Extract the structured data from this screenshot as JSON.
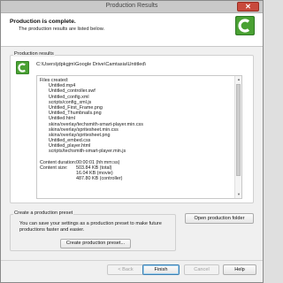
{
  "window": {
    "title": "Production Results",
    "close_glyph": "✕"
  },
  "header": {
    "title": "Production is complete.",
    "subtitle": "The production results are listed below.",
    "logo_icon": "camtasia-logo"
  },
  "results": {
    "group_label": "Production results",
    "path": "C:\\Users\\jdpkgjm\\Google Drive\\Camtasia\\Untitled\\",
    "files_label": "Files created:",
    "files": [
      "Untitled.mp4",
      "Untitled_controller.swf",
      "Untitled_config.xml",
      "scripts/config_xml.js",
      "Untitled_First_Frame.png",
      "Untitled_Thumbnails.png",
      "Untitled.html",
      "skins/overlay/techsmith-smart-player.min.css",
      "skins/overlay/spritesheet.min.css",
      "skins/overlay/spritesheet.png",
      "Untitled_embed.css",
      "Untitled_player.html",
      "scripts/techsmith-smart-player.min.js"
    ],
    "duration_label": "Content duration:",
    "duration_value": "00:00:01 (hh:mm:ss)",
    "size_label": "Content size:",
    "size_values": [
      "503.84 KB (total)",
      "16.04 KB (movie)",
      "487.80 KB (controller)"
    ]
  },
  "preset": {
    "group_label": "Create a production preset",
    "description": "You can save your settings as a production preset to make future productions faster and easier.",
    "button_label": "Create production preset..."
  },
  "open_folder_label": "Open production folder",
  "footer": {
    "back_label": "< Back",
    "finish_label": "Finish",
    "cancel_label": "Cancel",
    "help_label": "Help"
  },
  "colors": {
    "brand_green": "#3f8f2e",
    "titlebar": "#c9c9c9",
    "close_red": "#c84a3c"
  }
}
